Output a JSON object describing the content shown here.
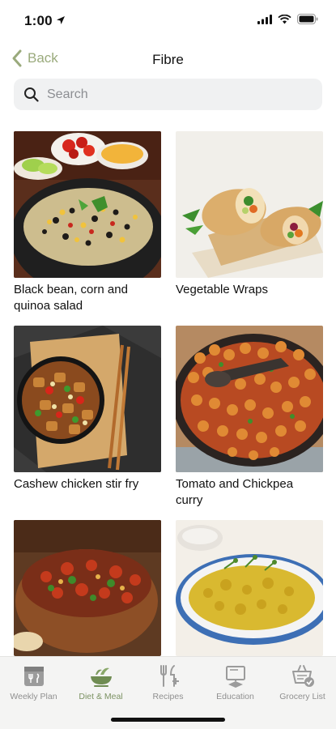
{
  "status": {
    "time": "1:00"
  },
  "nav": {
    "back_label": "Back",
    "title": "Fibre"
  },
  "search": {
    "placeholder": "Search"
  },
  "recipes": [
    {
      "title": "Black bean, corn and quinoa salad"
    },
    {
      "title": "Vegetable Wraps"
    },
    {
      "title": "Cashew chicken stir fry"
    },
    {
      "title": "Tomato and Chickpea curry"
    },
    {
      "title": ""
    },
    {
      "title": ""
    }
  ],
  "tabs": [
    {
      "label": "Weekly Plan",
      "icon": "weekly-plan-icon",
      "active": false
    },
    {
      "label": "Diet & Meal",
      "icon": "diet-meal-icon",
      "active": true
    },
    {
      "label": "Recipes",
      "icon": "recipes-icon",
      "active": false
    },
    {
      "label": "Education",
      "icon": "education-icon",
      "active": false
    },
    {
      "label": "Grocery List",
      "icon": "grocery-list-icon",
      "active": false
    }
  ],
  "colors": {
    "accent": "#9aaa7c",
    "active_tab": "#7c9263",
    "inactive_tab": "#8f8f8f"
  }
}
